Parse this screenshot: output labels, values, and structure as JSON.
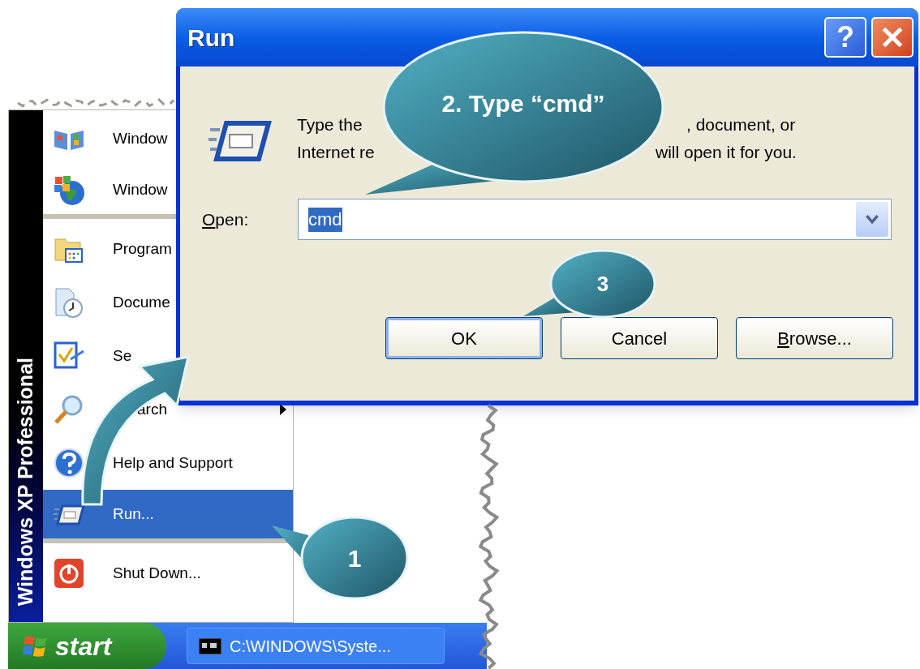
{
  "start_menu": {
    "banner": "Windows XP Professional",
    "items": [
      {
        "label": "Window",
        "selected": false,
        "covered_start": false,
        "separator_after": false
      },
      {
        "label": "Window",
        "selected": false,
        "covered_start": false,
        "separator_after": true
      },
      {
        "label": "Program",
        "selected": false,
        "covered_start": false,
        "separator_after": false
      },
      {
        "label": "Docume",
        "selected": false,
        "covered_start": false,
        "separator_after": false
      },
      {
        "label": "Se",
        "selected": false,
        "covered_start": false,
        "separator_after": false
      },
      {
        "label": "arch",
        "selected": false,
        "has_submenu": true,
        "covered_start": true,
        "separator_after": false
      },
      {
        "label": "Help and Support",
        "selected": false,
        "has_submenu": false,
        "covered_start": false,
        "separator_after": false
      },
      {
        "label": "Run...",
        "selected": true,
        "has_submenu": false,
        "covered_start": false,
        "separator_after": true
      },
      {
        "label": "Shut Down...",
        "selected": false,
        "has_submenu": false,
        "covered_start": false,
        "separator_after": false
      }
    ]
  },
  "taskbar": {
    "start_label": "start",
    "tasks": [
      {
        "label": "C:\\WINDOWS\\Syste..."
      }
    ]
  },
  "run_dialog": {
    "title": "Run",
    "help_glyph": "?",
    "description": [
      {
        "left": "Type the",
        "right": ", document, or"
      },
      {
        "left": "Internet re",
        "right": "will open it for you."
      }
    ],
    "open_label": "Open:",
    "open_label_underline_first": true,
    "open_value": "cmd",
    "value_selected": true,
    "buttons": [
      {
        "label": "OK",
        "default": true,
        "underline_first": false
      },
      {
        "label": "Cancel",
        "default": false,
        "underline_first": false
      },
      {
        "label": "Browse...",
        "default": false,
        "underline_first": true
      }
    ]
  },
  "callouts": [
    {
      "text": "1"
    },
    {
      "text": "2. Type “cmd”"
    },
    {
      "text": "3"
    }
  ]
}
